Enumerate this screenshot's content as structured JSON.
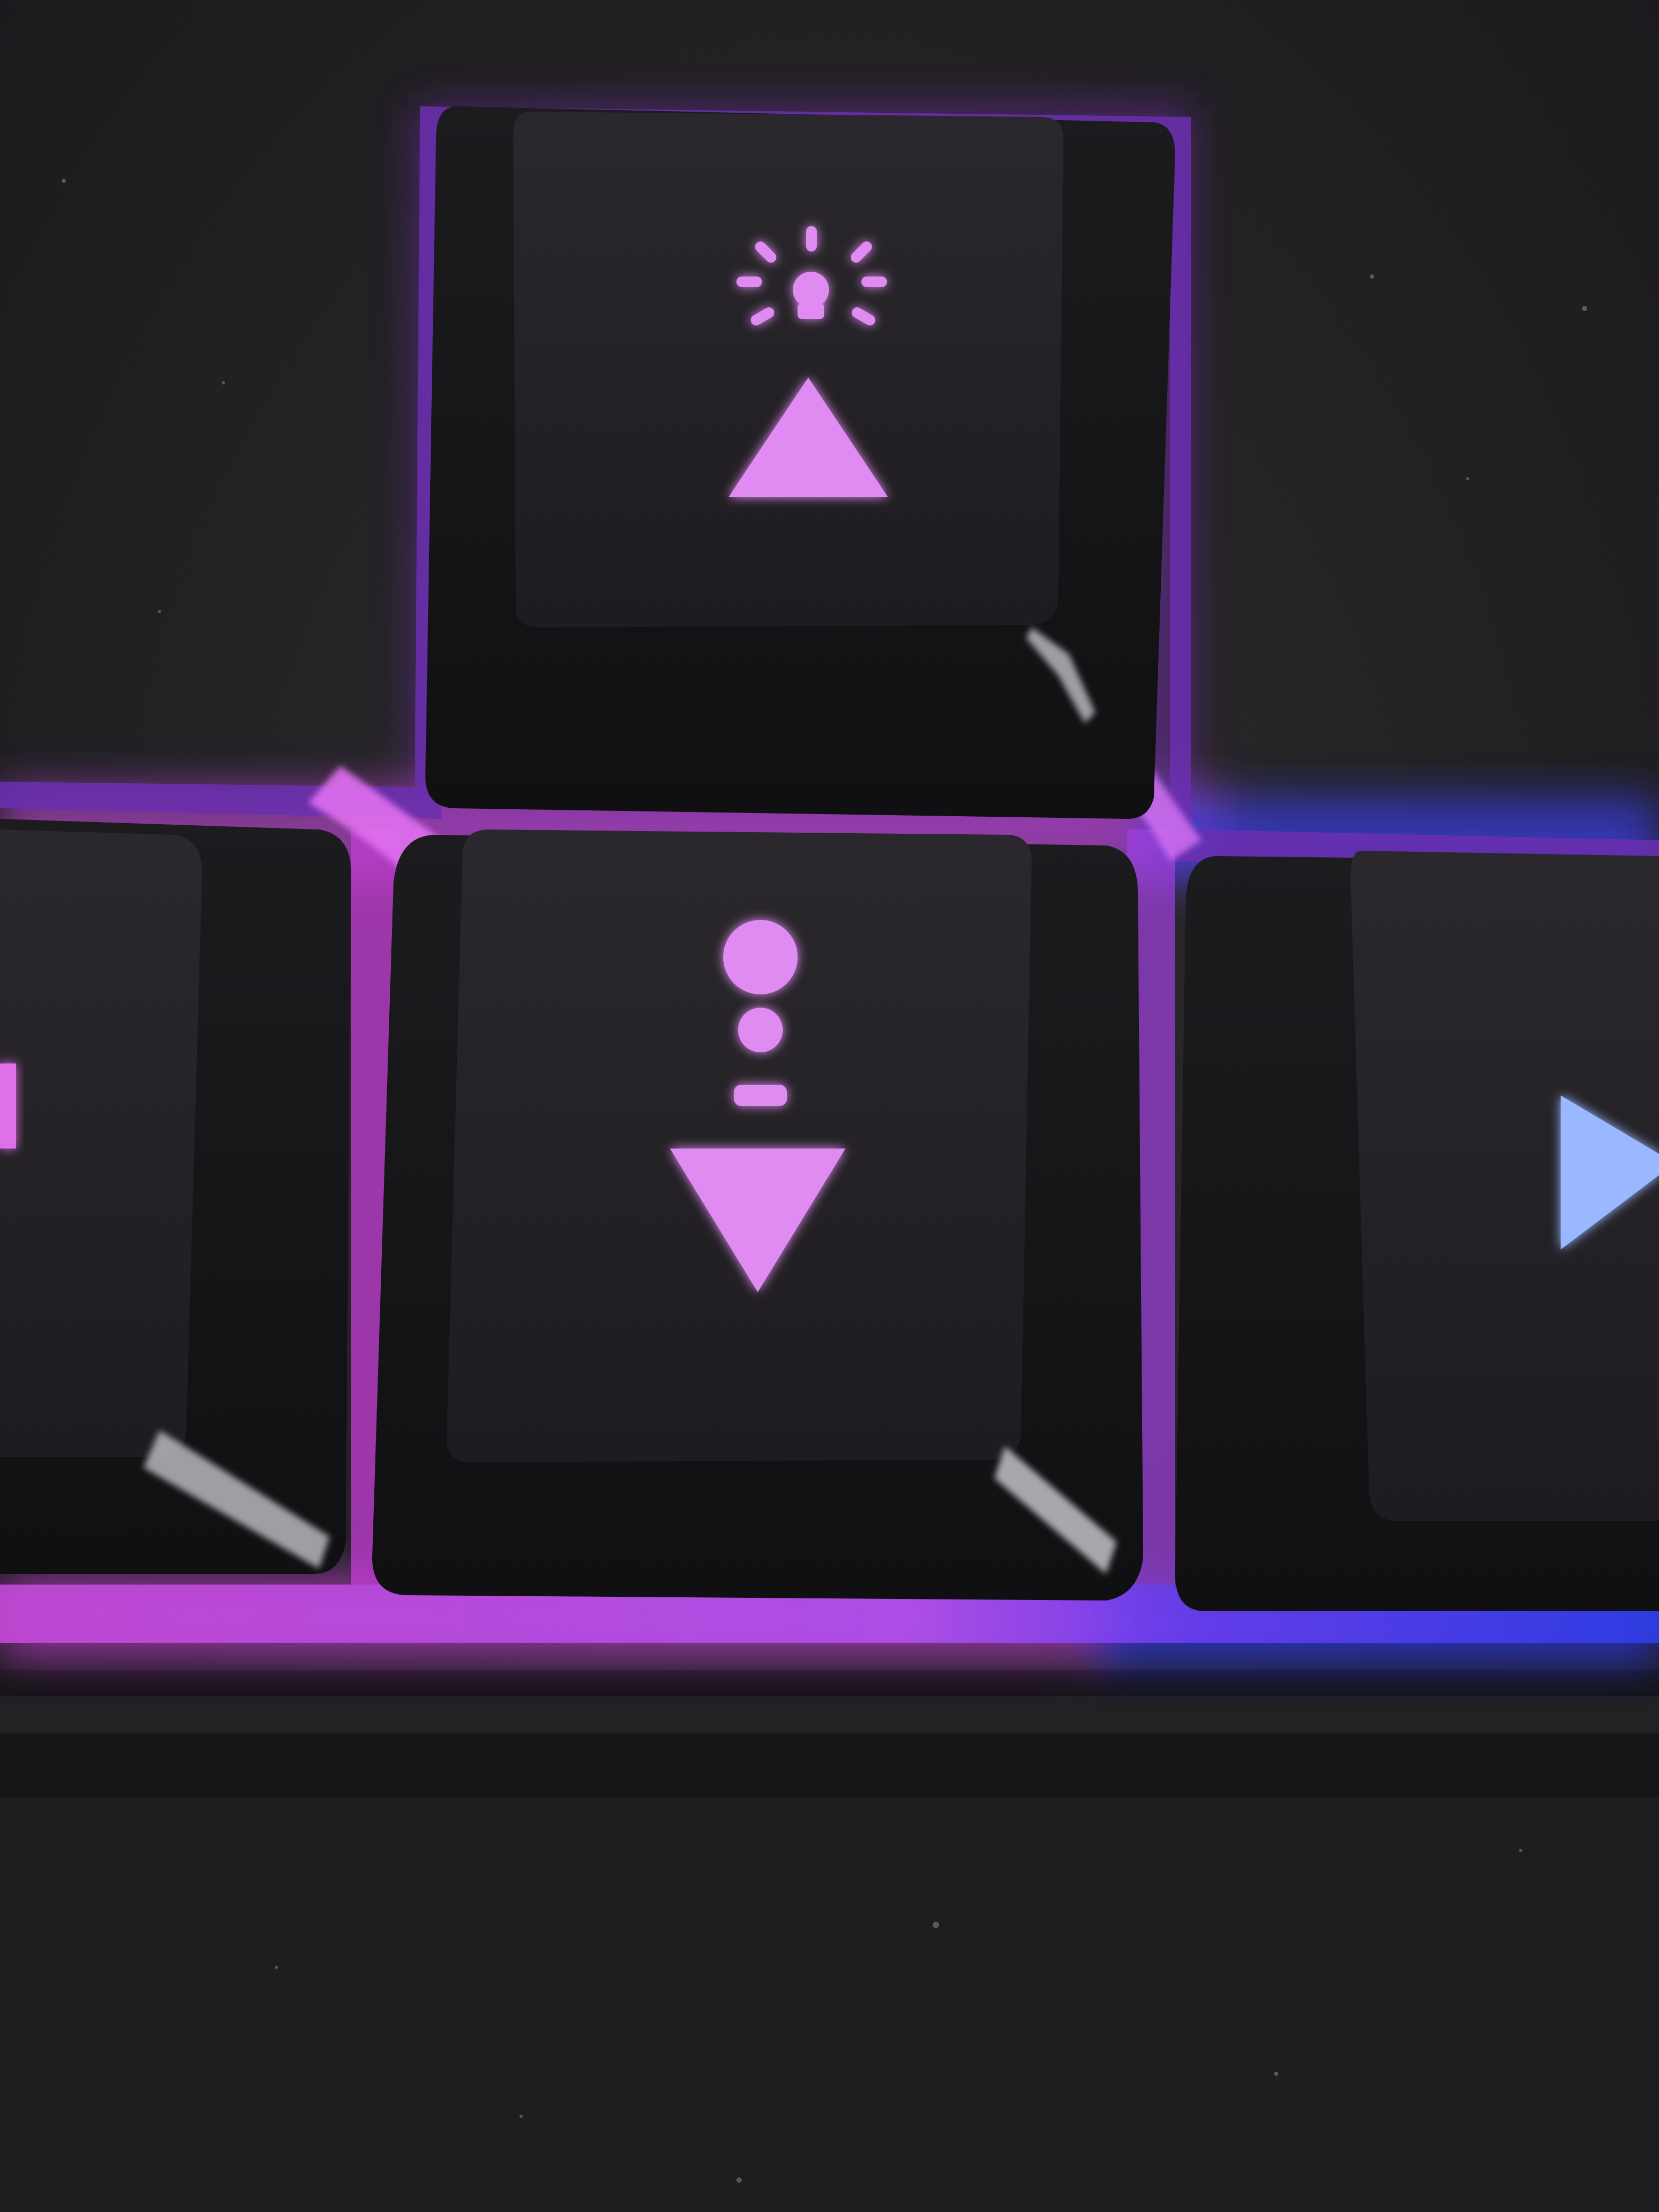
{
  "scene": {
    "subject": "backlit-keyboard-arrow-keys",
    "colors": {
      "keyboard_body": "#2a292b",
      "keyboard_body_dark": "#1a191b",
      "keycap_top": "#262428",
      "keycap_side": "#161517",
      "glow_purple": "#b44cf0",
      "glow_magenta": "#d04ad8",
      "glow_blue": "#3f4df5",
      "legend_purple": "#e08bf2",
      "legend_blue": "#9ab8ff"
    }
  },
  "keys": [
    {
      "name": "up-arrow-key",
      "legend_icons": [
        "brightness-up-icon",
        "up-triangle-icon"
      ],
      "legend_color": "#e08bf2"
    },
    {
      "name": "down-arrow-key",
      "legend_icons": [
        "brightness-down-icon",
        "down-triangle-icon"
      ],
      "legend_color": "#e08bf2"
    },
    {
      "name": "left-arrow-key",
      "legend_icons": [
        "left-triangle-icon"
      ],
      "legend_color": "#e070e8"
    },
    {
      "name": "right-arrow-key",
      "legend_icons": [
        "right-triangle-icon"
      ],
      "legend_color": "#9ab8ff"
    }
  ]
}
